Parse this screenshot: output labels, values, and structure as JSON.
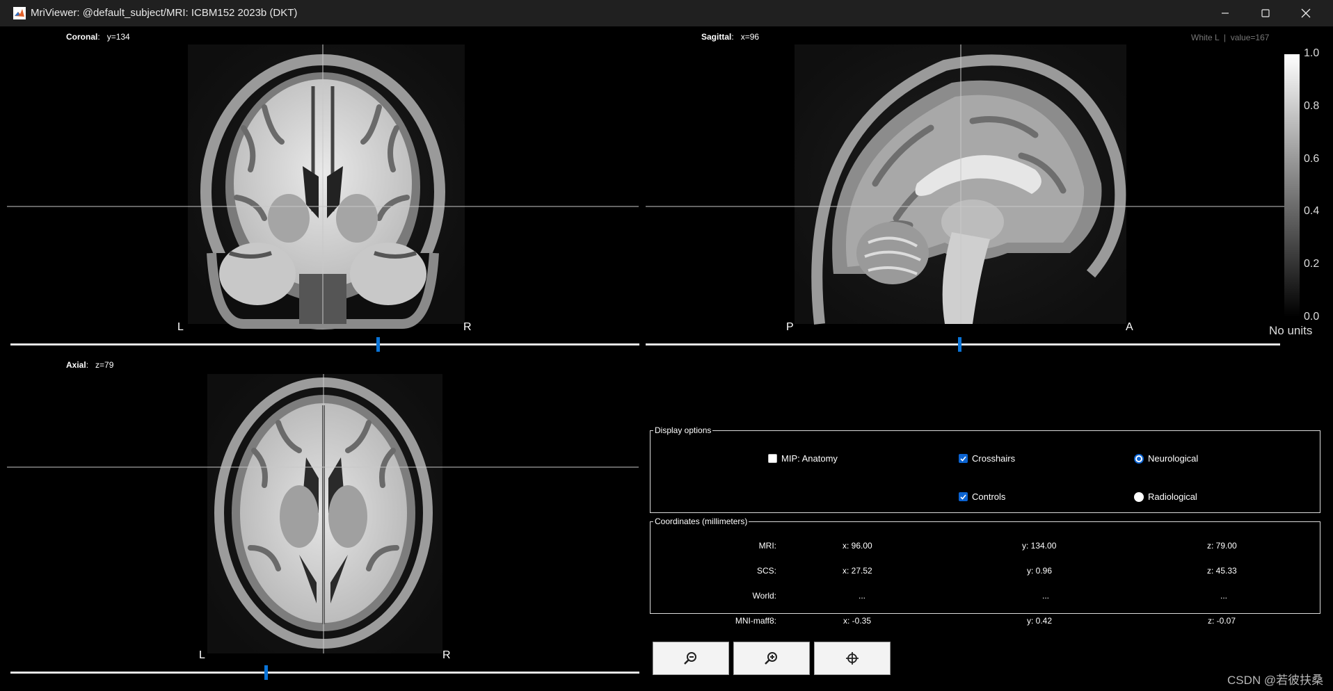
{
  "window": {
    "title": "MriViewer: @default_subject/MRI: ICBM152 2023b (DKT)"
  },
  "coronal": {
    "name": "Coronal",
    "coord": "y=134",
    "left": "L",
    "right": "R",
    "slider_fraction": 0.584
  },
  "sagittal": {
    "name": "Sagittal",
    "coord": "x=96",
    "left": "P",
    "right": "A",
    "slider_fraction": 0.494
  },
  "axial": {
    "name": "Axial",
    "coord": "z=79",
    "left": "L",
    "right": "R",
    "slider_fraction": 0.406
  },
  "value_info": {
    "label": "White L",
    "sep": "|",
    "value": "value=167"
  },
  "colorbar": {
    "ticks": [
      "1.0",
      "0.8",
      "0.6",
      "0.4",
      "0.2",
      "0.0"
    ],
    "units": "No units"
  },
  "display_options": {
    "legend": "Display options",
    "mip": {
      "label": "MIP: Anatomy",
      "checked": false
    },
    "crosshairs": {
      "label": "Crosshairs",
      "checked": true
    },
    "controls": {
      "label": "Controls",
      "checked": true
    },
    "neurological": {
      "label": "Neurological",
      "selected": true
    },
    "radiological": {
      "label": "Radiological",
      "selected": false
    }
  },
  "coordinates": {
    "legend": "Coordinates (millimeters)",
    "rows": [
      {
        "label": "MRI:",
        "x": "x: 96.00",
        "y": "y: 134.00",
        "z": "z: 79.00"
      },
      {
        "label": "SCS:",
        "x": "x: 27.52",
        "y": "y: 0.96",
        "z": "z: 45.33"
      },
      {
        "label": "World:",
        "x": "...",
        "y": "...",
        "z": "..."
      },
      {
        "label": "MNI-maff8:",
        "x": "x: -0.35",
        "y": "y: 0.42",
        "z": "z: -0.07"
      }
    ]
  },
  "toolbar": {
    "buttons": [
      "zoom-out-icon",
      "zoom-in-icon",
      "center-crosshair-icon"
    ]
  },
  "watermark": "CSDN @若彼扶桑",
  "colors": {
    "accent": "#0a74d8",
    "background": "#000000",
    "titlebar": "#202020"
  }
}
